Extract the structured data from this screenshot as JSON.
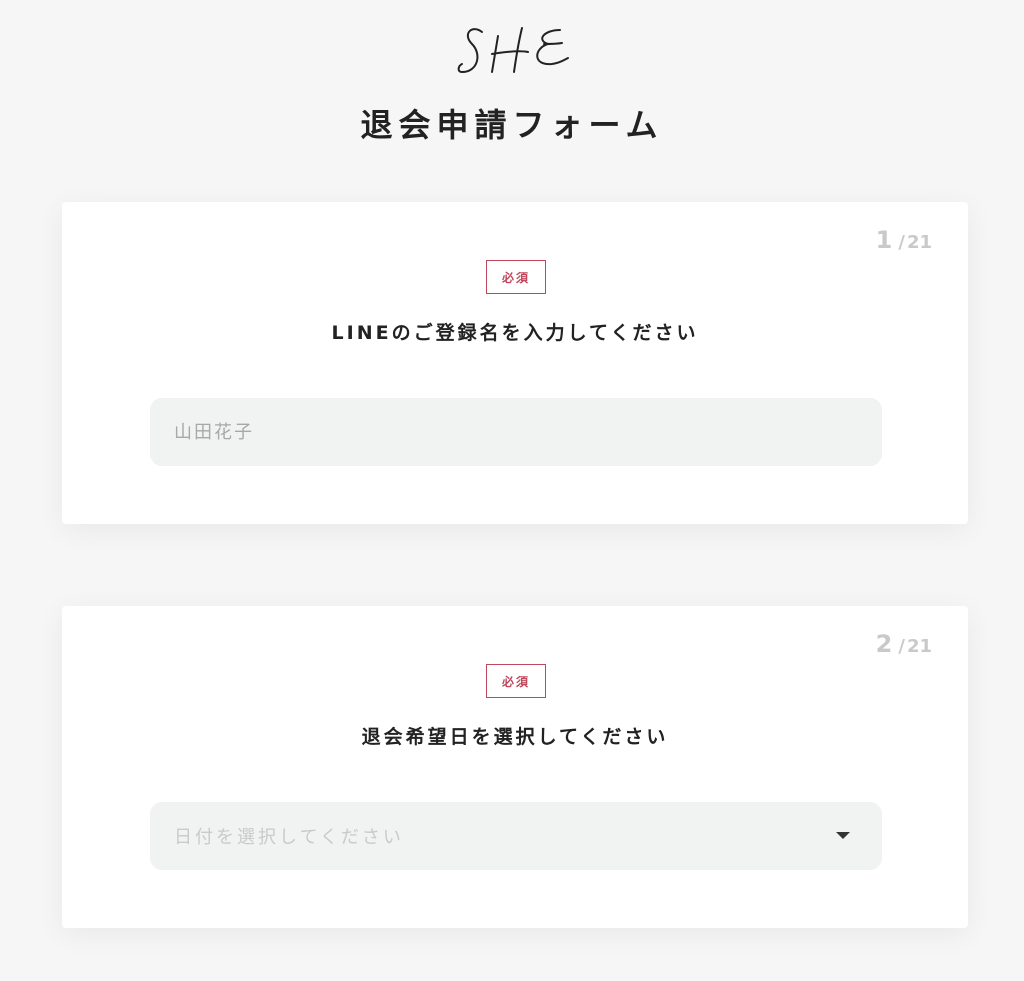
{
  "brand": {
    "logo_text": "SHE"
  },
  "header": {
    "title": "退会申請フォーム"
  },
  "questions": [
    {
      "number": "1",
      "separator": "/",
      "total": "21",
      "required_label": "必須",
      "label": "LINEのご登録名を入力してください",
      "input_placeholder": "山田花子",
      "input_value": ""
    },
    {
      "number": "2",
      "separator": "/",
      "total": "21",
      "required_label": "必須",
      "label": "退会希望日を選択してください",
      "select_placeholder": "日付を選択してください"
    }
  ],
  "colors": {
    "accent": "#c0485d",
    "field_bg": "#f1f2f2",
    "page_bg": "#f6f6f6"
  }
}
